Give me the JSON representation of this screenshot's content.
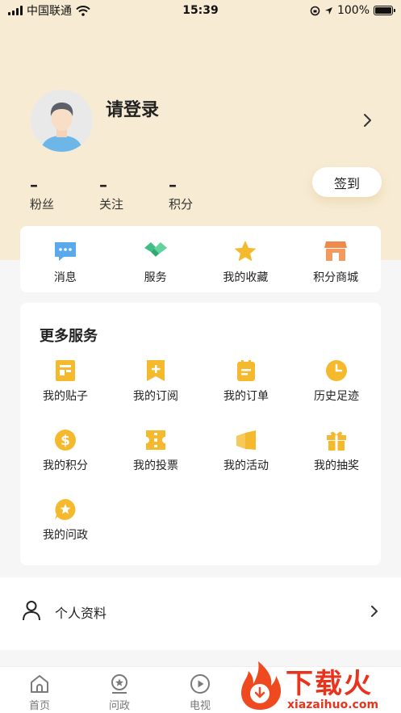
{
  "status_bar": {
    "carrier": "中国联通",
    "time": "15:39",
    "battery": "100%"
  },
  "profile": {
    "login_text": "请登录"
  },
  "stats": [
    {
      "value": "–",
      "label": "粉丝"
    },
    {
      "value": "–",
      "label": "关注"
    },
    {
      "value": "–",
      "label": "积分"
    }
  ],
  "checkin_label": "签到",
  "quick_actions": [
    {
      "label": "消息",
      "icon": "message-icon"
    },
    {
      "label": "服务",
      "icon": "handshake-icon"
    },
    {
      "label": "我的收藏",
      "icon": "star-icon"
    },
    {
      "label": "积分商城",
      "icon": "store-icon"
    }
  ],
  "more_services": {
    "title": "更多服务",
    "items": [
      {
        "label": "我的贴子",
        "icon": "post-icon"
      },
      {
        "label": "我的订阅",
        "icon": "subscribe-icon"
      },
      {
        "label": "我的订单",
        "icon": "order-icon"
      },
      {
        "label": "历史足迹",
        "icon": "history-icon"
      },
      {
        "label": "我的积分",
        "icon": "points-icon"
      },
      {
        "label": "我的投票",
        "icon": "vote-icon"
      },
      {
        "label": "我的活动",
        "icon": "activity-icon"
      },
      {
        "label": "我的抽奖",
        "icon": "gift-icon"
      },
      {
        "label": "我的问政",
        "icon": "inquiry-icon"
      }
    ]
  },
  "list": {
    "profile_label": "个人资料"
  },
  "tabs": [
    {
      "label": "首页",
      "icon": "home-icon"
    },
    {
      "label": "问政",
      "icon": "inquiry-tab-icon"
    },
    {
      "label": "电视",
      "icon": "tv-icon"
    }
  ],
  "watermark": {
    "text": "下载火",
    "url": "xiazaihuo.com"
  },
  "colors": {
    "header_bg": "#f7ebd3",
    "accent_yellow": "#f5b92d",
    "brand_red": "#e8341c"
  }
}
